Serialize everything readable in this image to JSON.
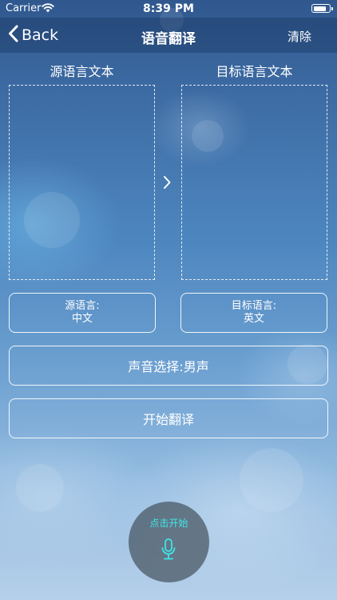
{
  "status_bar": {
    "carrier": "Carrier",
    "time": "8:39 PM",
    "battery_level": 0.85
  },
  "nav": {
    "back_label": "Back",
    "title": "语音翻译",
    "clear_label": "清除"
  },
  "source_panel": {
    "title": "源语言文本",
    "text": ""
  },
  "target_panel": {
    "title": "目标语言文本",
    "text": ""
  },
  "source_language": {
    "label": "源语言:",
    "value": "中文"
  },
  "target_language": {
    "label": "目标语言:",
    "value": "英文"
  },
  "voice_select": {
    "label": "声音选择:男声"
  },
  "start_translate": {
    "label": "开始翻译"
  },
  "record": {
    "label": "点击开始",
    "accent_color": "#3ee6e6"
  },
  "icons": [
    "wifi-icon",
    "battery-icon",
    "chevron-left-icon",
    "chevron-right-icon",
    "microphone-icon"
  ]
}
